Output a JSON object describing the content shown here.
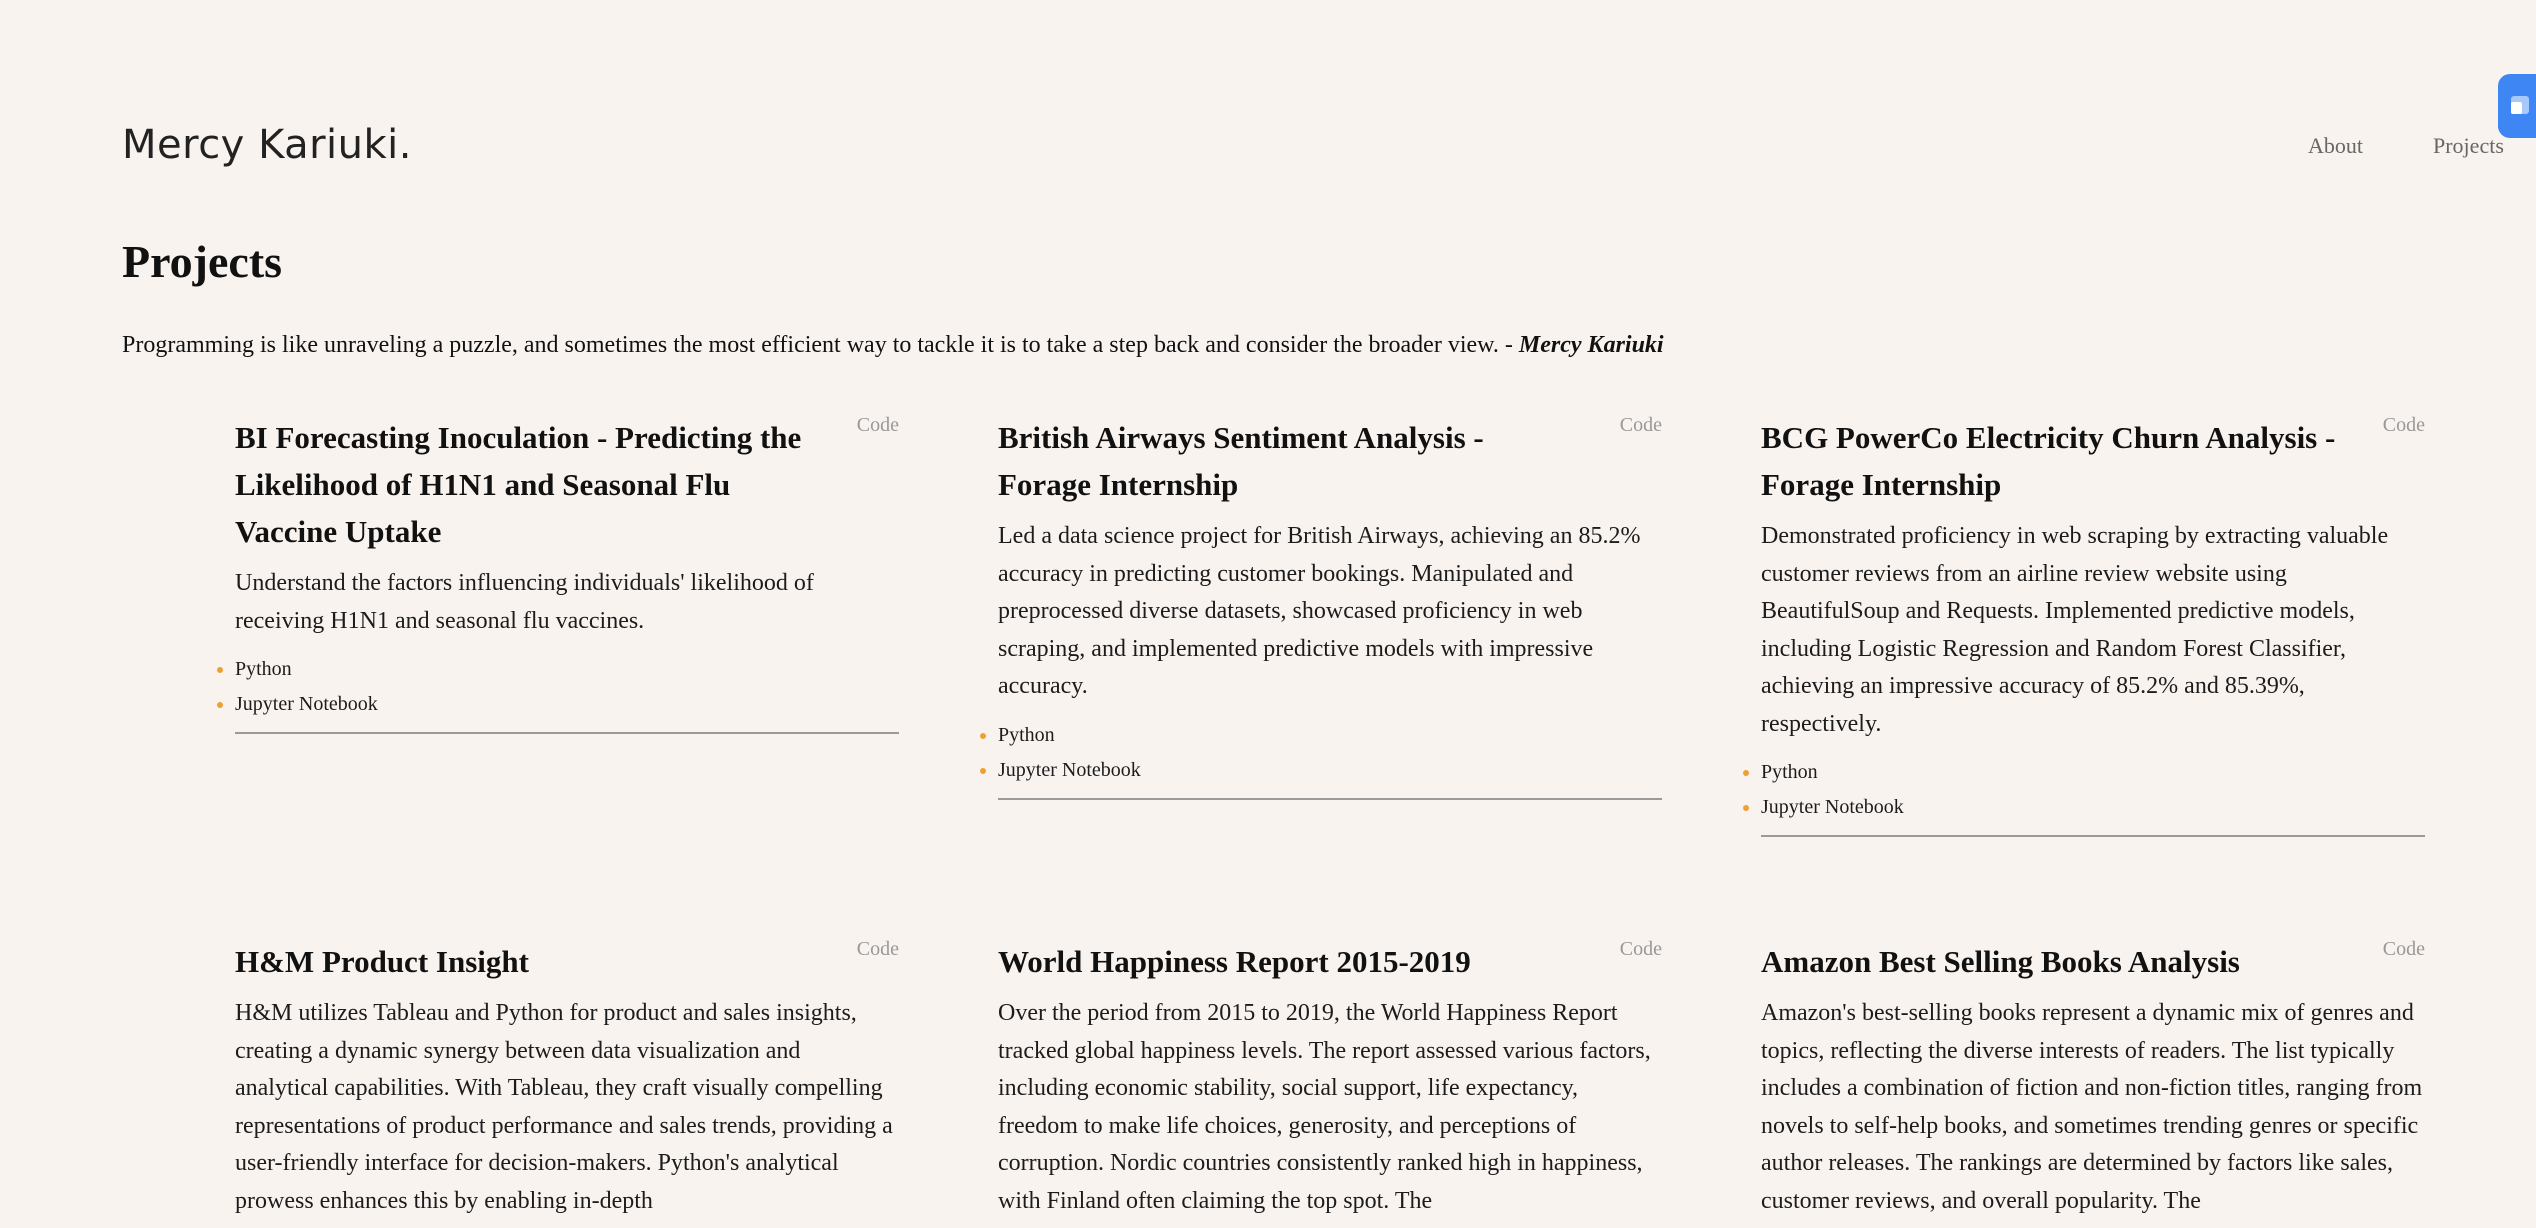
{
  "site": {
    "logo": "Mercy Kariuki.",
    "nav": [
      {
        "label": "About"
      },
      {
        "label": "Projects"
      }
    ]
  },
  "page": {
    "title": "Projects",
    "quote": "Programming is like unraveling a puzzle, and sometimes the most efficient way to tackle it is to take a step back and consider the broader view. -",
    "quote_author": "Mercy Kariuki"
  },
  "projects": [
    {
      "title": "BI Forecasting Inoculation - Predicting the Likelihood of H1N1 and Seasonal Flu Vaccine Uptake",
      "code_label": "Code",
      "description": "Understand the factors influencing individuals' likelihood of receiving H1N1 and seasonal flu vaccines.",
      "tags": [
        "Python",
        "Jupyter Notebook"
      ]
    },
    {
      "title": "British Airways Sentiment Analysis - Forage Internship",
      "code_label": "Code",
      "description": "Led a data science project for British Airways, achieving an 85.2% accuracy in predicting customer bookings. Manipulated and preprocessed diverse datasets, showcased proficiency in web scraping, and implemented predictive models with impressive accuracy.",
      "tags": [
        "Python",
        "Jupyter Notebook"
      ]
    },
    {
      "title": "BCG PowerCo Electricity Churn Analysis - Forage Internship",
      "code_label": "Code",
      "description": "Demonstrated proficiency in web scraping by extracting valuable customer reviews from an airline review website using BeautifulSoup and Requests. Implemented predictive models, including Logistic Regression and Random Forest Classifier, achieving an impressive accuracy of 85.2% and 85.39%, respectively.",
      "tags": [
        "Python",
        "Jupyter Notebook"
      ]
    },
    {
      "title": "H&M Product Insight",
      "code_label": "Code",
      "description": "H&M utilizes Tableau and Python for product and sales insights, creating a dynamic synergy between data visualization and analytical capabilities. With Tableau, they craft visually compelling representations of product performance and sales trends, providing a user-friendly interface for decision-makers. Python's analytical prowess enhances this by enabling in-depth",
      "tags": []
    },
    {
      "title": "World Happiness Report 2015-2019",
      "code_label": "Code",
      "description": "Over the period from 2015 to 2019, the World Happiness Report tracked global happiness levels. The report assessed various factors, including economic stability, social support, life expectancy, freedom to make life choices, generosity, and perceptions of corruption. Nordic countries consistently ranked high in happiness, with Finland often claiming the top spot. The",
      "tags": []
    },
    {
      "title": "Amazon Best Selling Books Analysis",
      "code_label": "Code",
      "description": "Amazon's best-selling books represent a dynamic mix of genres and topics, reflecting the diverse interests of readers. The list typically includes a combination of fiction and non-fiction titles, ranging from novels to self-help books, and sometimes trending genres or specific author releases. The rankings are determined by factors like sales, customer reviews, and overall popularity. The",
      "tags": []
    }
  ],
  "colors": {
    "background": "#f9f3ef",
    "bullet": "#f0a030",
    "widget": "#3d86f3",
    "nav_text": "#666666",
    "code_text": "#999999"
  },
  "icons": {
    "widget": "side-widget-icon"
  }
}
